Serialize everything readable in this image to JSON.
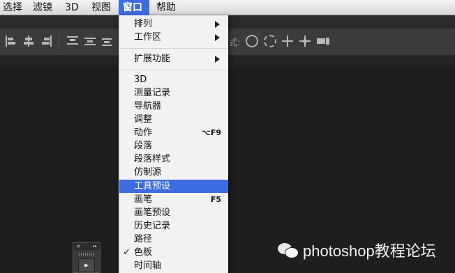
{
  "menubar": {
    "items": [
      {
        "label": "选择"
      },
      {
        "label": "滤镜"
      },
      {
        "label": "3D"
      },
      {
        "label": "视图"
      },
      {
        "label": "窗口",
        "active": true
      },
      {
        "label": "帮助"
      }
    ]
  },
  "options_bar": {
    "mode_label": "式:"
  },
  "window_menu": {
    "items": [
      {
        "label": "排列",
        "submenu": true
      },
      {
        "label": "工作区",
        "submenu": true
      },
      {
        "label": "扩展功能",
        "submenu": true
      },
      {
        "label": "3D"
      },
      {
        "label": "测量记录"
      },
      {
        "label": "导航器"
      },
      {
        "label": "调整"
      },
      {
        "label": "动作",
        "shortcut": "⌥F9"
      },
      {
        "label": "段落"
      },
      {
        "label": "段落样式"
      },
      {
        "label": "仿制源"
      },
      {
        "label": "工具预设",
        "highlighted": true
      },
      {
        "label": "画笔",
        "shortcut": "F5"
      },
      {
        "label": "画笔预设"
      },
      {
        "label": "历史记录"
      },
      {
        "label": "路径"
      },
      {
        "label": "色板",
        "checked": true
      },
      {
        "label": "时间轴"
      }
    ]
  },
  "tool_panel": {
    "close_glyph": "×",
    "collapse_glyph": "▸▸",
    "tool_glyph": "▸"
  },
  "watermark": {
    "text": "photoshop教程论坛"
  },
  "colors": {
    "accent": "#3d6be0",
    "menu_bg": "#f2f2f2",
    "workspace_bg": "#1e1e1e"
  }
}
